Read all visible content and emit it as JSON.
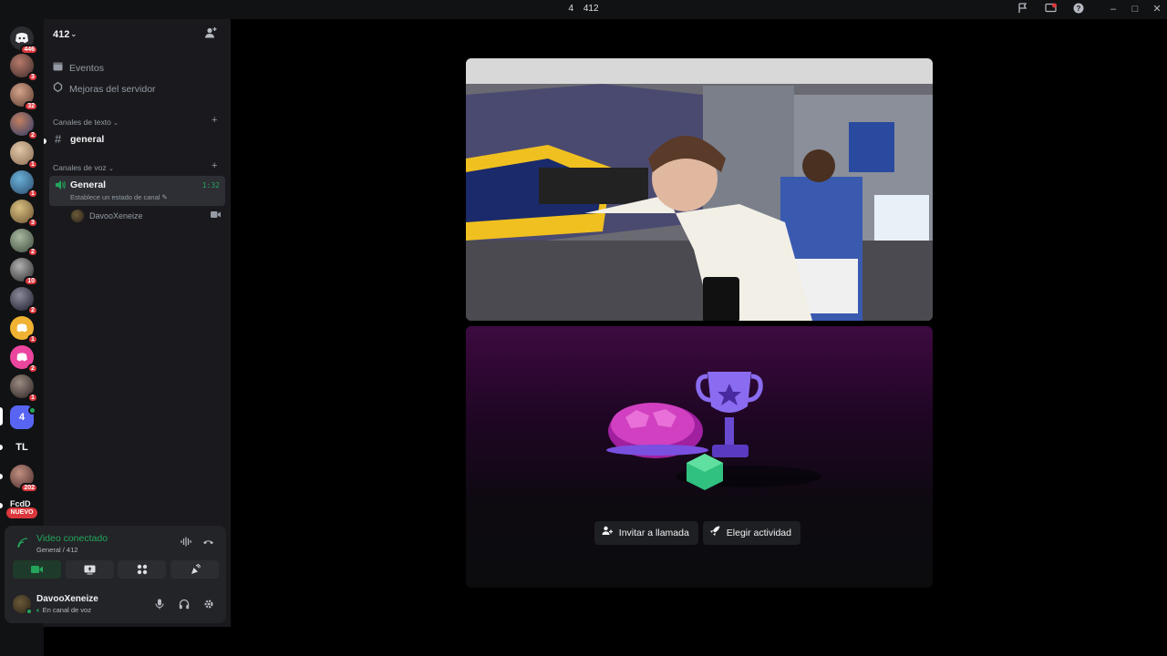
{
  "titlebar": {
    "left_num": "4",
    "title": "412",
    "icons": [
      "inbox-flag-icon",
      "screen-share-icon",
      "help-icon"
    ],
    "window_controls": [
      "minimize",
      "maximize",
      "close"
    ]
  },
  "rail": {
    "badges": [
      "446",
      "3",
      "32",
      "2",
      "1",
      "1",
      "3",
      "2",
      "10",
      "2",
      "1",
      "2",
      "1",
      "202"
    ],
    "folder_label": "4",
    "tl_label": "TL",
    "partial_label": "FcdD",
    "nuevo": "NUEVO"
  },
  "sidebar": {
    "server_name": "412",
    "events": "Eventos",
    "boosts": "Mejoras del servidor",
    "text_category": "Canales de texto",
    "text_channel": "general",
    "voice_category": "Canales de voz",
    "voice_channel": "General",
    "voice_time": "1:32",
    "voice_status": "Establece un estado de canal",
    "voice_user": "DavooXeneize"
  },
  "panel": {
    "title": "Video conectado",
    "subtitle": "General / 412",
    "username": "DavooXeneize",
    "user_status": "En canal de voz"
  },
  "stage": {
    "invite": "Invitar a llamada",
    "activity": "Elegir actividad"
  },
  "colors": {
    "green": "#23a55a",
    "red": "#da373c",
    "blurple": "#5865f2"
  }
}
